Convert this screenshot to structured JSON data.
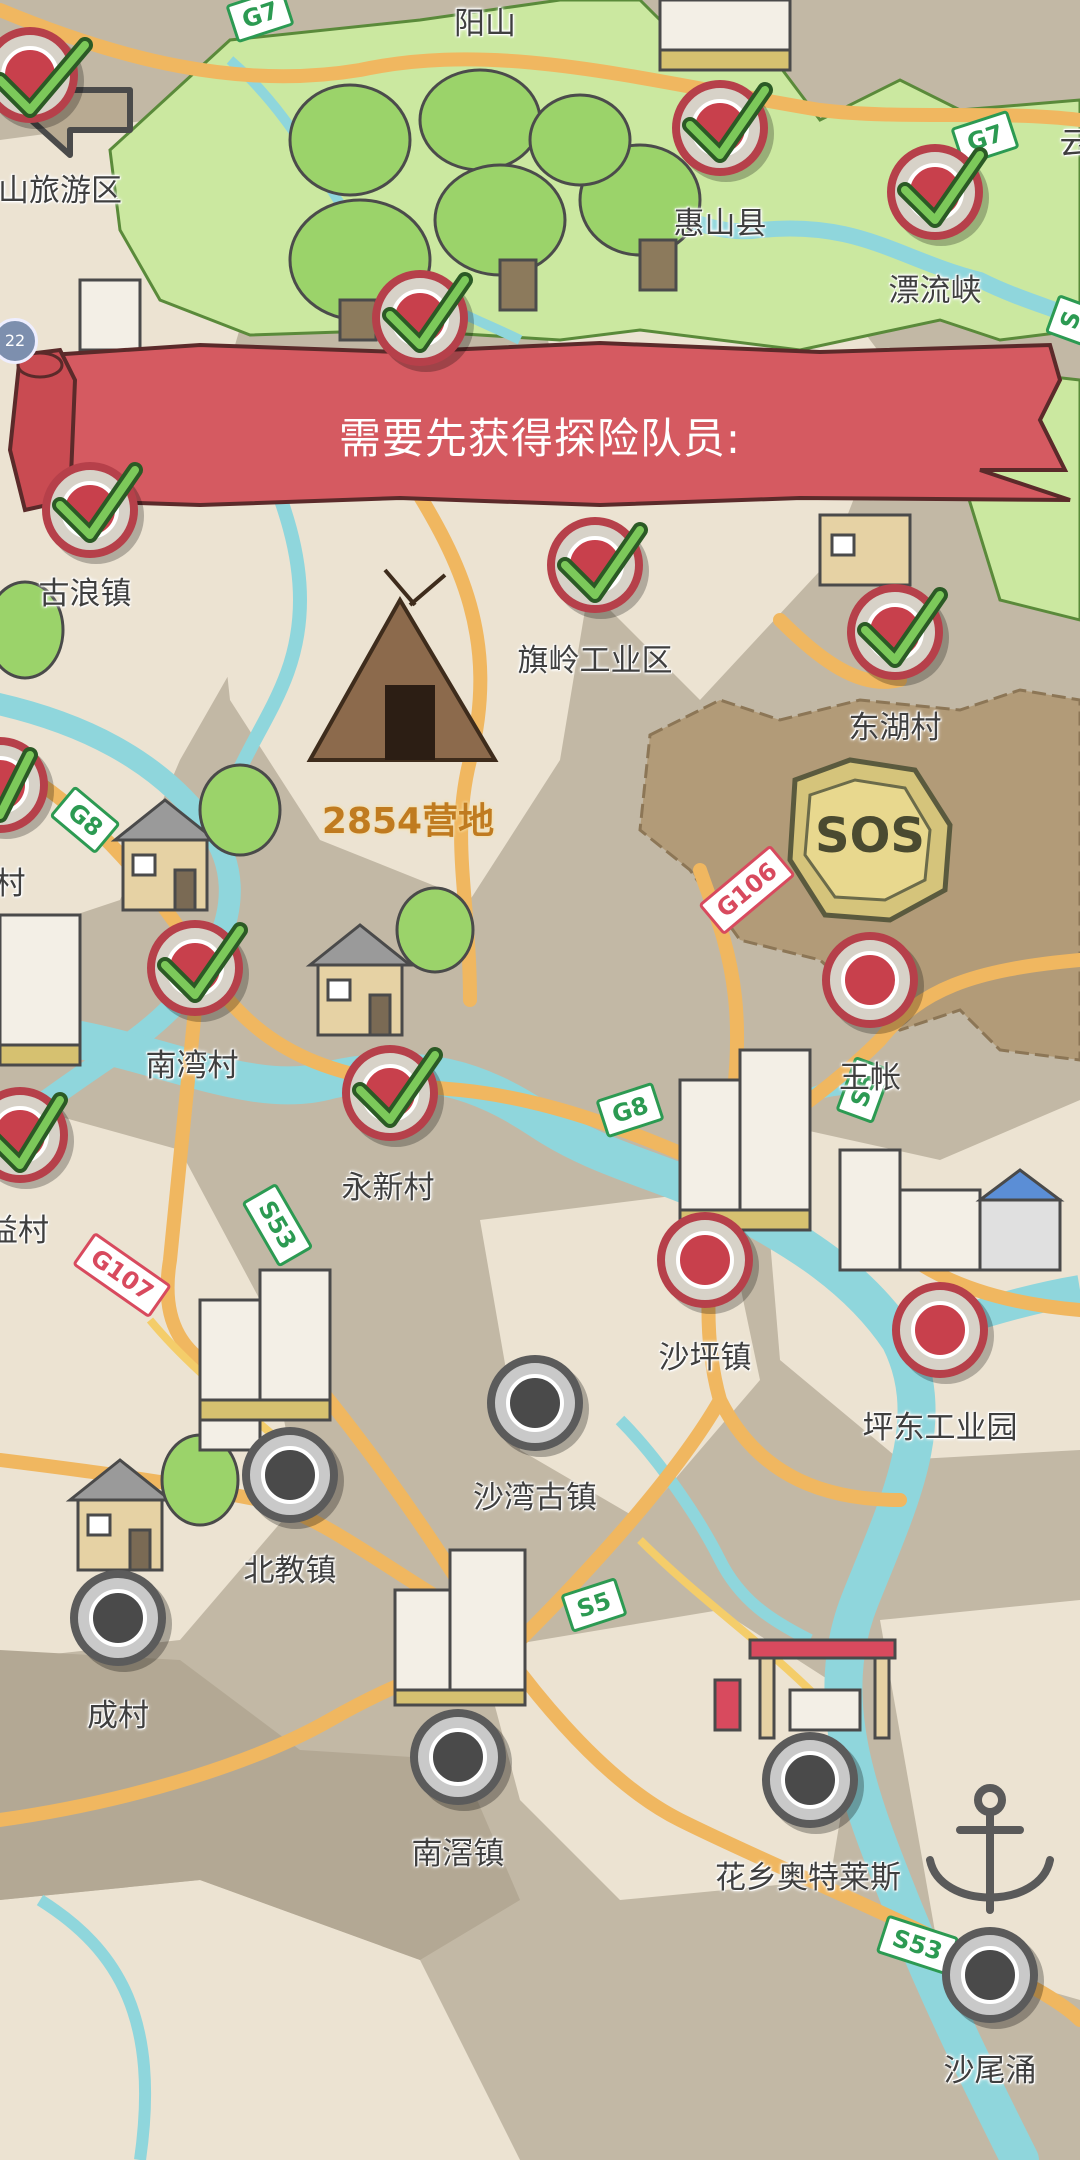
{
  "banner": {
    "text": "需要先获得探险队员:"
  },
  "back_button": {
    "label": "back"
  },
  "left_badge": {
    "text": "22"
  },
  "sos_text": "SOS",
  "locations": [
    {
      "id": "yangshan",
      "name": "阳山",
      "state": "none"
    },
    {
      "id": "tourist",
      "name": "山旅游区",
      "state": "checked"
    },
    {
      "id": "huishan",
      "name": "惠山县",
      "state": "checked"
    },
    {
      "id": "piaoliu",
      "name": "漂流峡",
      "state": "checked"
    },
    {
      "id": "yun",
      "name": "云",
      "state": "none"
    },
    {
      "id": "forest",
      "name": "",
      "state": "checked"
    },
    {
      "id": "gulang",
      "name": "古浪镇",
      "state": "checked"
    },
    {
      "id": "qiling",
      "name": "旗岭工业区",
      "state": "checked"
    },
    {
      "id": "donghu",
      "name": "东湖村",
      "state": "checked"
    },
    {
      "id": "camp",
      "name": "2854营地",
      "state": "none"
    },
    {
      "id": "cun",
      "name": "村",
      "state": "checked"
    },
    {
      "id": "wangzhang",
      "name": "王帐",
      "state": "red"
    },
    {
      "id": "nanwan",
      "name": "南湾村",
      "state": "checked"
    },
    {
      "id": "yongxin",
      "name": "永新村",
      "state": "checked"
    },
    {
      "id": "jicun",
      "name": "益村",
      "state": "checked"
    },
    {
      "id": "shaping",
      "name": "沙坪镇",
      "state": "red"
    },
    {
      "id": "pingdong",
      "name": "坪东工业园",
      "state": "red"
    },
    {
      "id": "shawan",
      "name": "沙湾古镇",
      "state": "grey"
    },
    {
      "id": "beijiao",
      "name": "北教镇",
      "state": "grey"
    },
    {
      "id": "chengcun",
      "name": "成村",
      "state": "grey"
    },
    {
      "id": "nanyao",
      "name": "南滘镇",
      "state": "grey"
    },
    {
      "id": "huaxiang",
      "name": "花乡奥特莱斯",
      "state": "grey"
    },
    {
      "id": "shawei",
      "name": "沙尾涌",
      "state": "grey"
    }
  ],
  "road_signs": [
    {
      "text": "G7",
      "style": "green"
    },
    {
      "text": "G7",
      "style": "green"
    },
    {
      "text": "G8",
      "style": "green"
    },
    {
      "text": "G106",
      "style": "red"
    },
    {
      "text": "G8",
      "style": "green"
    },
    {
      "text": "S53",
      "style": "green"
    },
    {
      "text": "G107",
      "style": "red"
    },
    {
      "text": "S5",
      "style": "green"
    },
    {
      "text": "S53",
      "style": "green"
    },
    {
      "text": "S5",
      "style": "green"
    },
    {
      "text": "S",
      "style": "green"
    }
  ],
  "colors": {
    "land": "#c2b8a5",
    "plain": "#ece3d2",
    "grass": "#cbe8a0",
    "river": "#8fd6dc",
    "road": "#f0b760",
    "banner": "#d55a61",
    "marker_red": "#c8404c",
    "marker_grey": "#4a4a4a",
    "check": "#3e9a3a"
  }
}
